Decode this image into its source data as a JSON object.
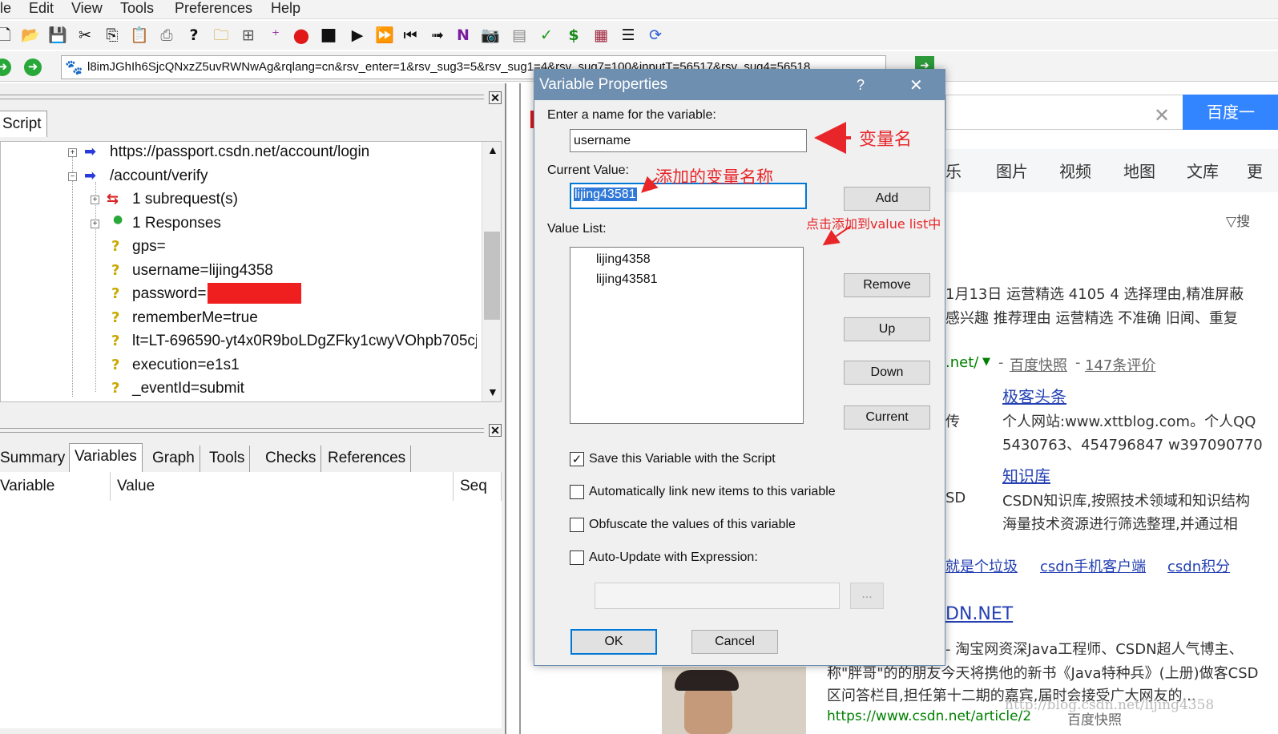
{
  "menu": [
    "le",
    "Edit",
    "View",
    "Tools",
    "Preferences",
    "Help"
  ],
  "toolbar_icons": [
    "new-icon",
    "open-icon",
    "save-icon",
    "cut-icon",
    "copy-icon",
    "paste-icon",
    "print-icon",
    "help-icon",
    "new-folder-icon",
    "add-item-icon",
    "add-variable-icon",
    "record-icon",
    "stop-icon",
    "play-icon",
    "fast-forward-icon",
    "step-back-icon",
    "step-icon",
    "n-icon",
    "camera-icon",
    "report-icon",
    "check-icon",
    "dollar-icon",
    "grid-icon",
    "tree-icon",
    "refresh-icon"
  ],
  "address": {
    "url": "l8imJGhIh6SjcQNxzZ5uvRWNwAg&rqlang=cn&rsv_enter=1&rsv_sug3=5&rsv_sug1=4&rsv_sug7=100&inputT=56517&rsv_sug4=56518"
  },
  "left_panel": {
    "tab_script": "Script",
    "tree": [
      {
        "text": "https://passport.csdn.net/account/login"
      },
      {
        "text": "/account/verify"
      },
      {
        "text": "1 subrequest(s)"
      },
      {
        "text": "1 Responses"
      },
      {
        "text": "gps="
      },
      {
        "text": "username=lijing4358"
      },
      {
        "text": "password="
      },
      {
        "text": "rememberMe=true"
      },
      {
        "text": "lt=LT-696590-yt4x0R9boLDgZFky1cwyVOhpb705cj"
      },
      {
        "text": "execution=e1s1"
      },
      {
        "text": "_eventId=submit"
      }
    ],
    "bottom_tabs": [
      "Summary",
      "Variables",
      "Graph",
      "Tools",
      "Checks",
      "References"
    ],
    "columns": [
      "Variable",
      "Value",
      "Seq"
    ]
  },
  "dialog": {
    "title": "Variable Properties",
    "help": "?",
    "close": "✕",
    "name_label": "Enter a name for the variable:",
    "name_value": "username",
    "current_label": "Current Value:",
    "current_value": "lijing43581",
    "list_label": "Value List:",
    "list_items": [
      "lijing4358",
      "lijing43581"
    ],
    "buttons": {
      "add": "Add",
      "remove": "Remove",
      "up": "Up",
      "down": "Down",
      "current": "Current",
      "ok": "OK",
      "cancel": "Cancel",
      "ellipsis": "..."
    },
    "checkboxes": [
      {
        "label": "Save this Variable with the Script",
        "checked": true
      },
      {
        "label": "Automatically link new items to this variable",
        "checked": false
      },
      {
        "label": "Obfuscate the values of this variable",
        "checked": false
      },
      {
        "label": "Auto-Update with Expression:",
        "checked": false
      }
    ]
  },
  "annotations": {
    "var_name": "变量名",
    "added_name": "添加的变量名称",
    "click_add": "点击添加到value list中"
  },
  "browser": {
    "search_button": "百度一",
    "nav_items": [
      "乐",
      "图片",
      "视频",
      "地图",
      "文库",
      "更"
    ],
    "search_tools": "搜",
    "line1": "1月13日 运营精选 4105 4 选择理由,精准屏蔽",
    "line2": "感兴趣 推荐理由 运营精选 不准确 旧闻、重复",
    "url1": ".net/",
    "kuaizhao": "百度快照",
    "reviews": "147条评价",
    "link1": "极客头条",
    "chuan": "传",
    "desc1": "个人网站:www.xttblog.com。个人QQ",
    "desc2": "5430763、454796847 w397090770",
    "link2": "知识库",
    "sd": "SD",
    "desc3": "CSDN知识库,按照技术领域和知识结构",
    "desc4": "海量技术资源进行筛选整理,并通过相",
    "bottom_links": [
      "就是个垃圾",
      "csdn手机客户端",
      "csdn积分"
    ],
    "title2": "DN.NET",
    "desc5": "- 淘宝网资深Java工程师、CSDN超人气博主、",
    "desc6": "称\"胖哥\"的的朋友今天将携他的新书《Java特种兵》(上册)做客CSD",
    "desc7": "区问答栏目,担任第十二期的嘉宾,届时会接受广大网友的...",
    "url2": "https://www.csdn.net/article/2",
    "kuaizhao2": "百度快照",
    "watermark": "http://blog.csdn.net/lijing4358"
  }
}
